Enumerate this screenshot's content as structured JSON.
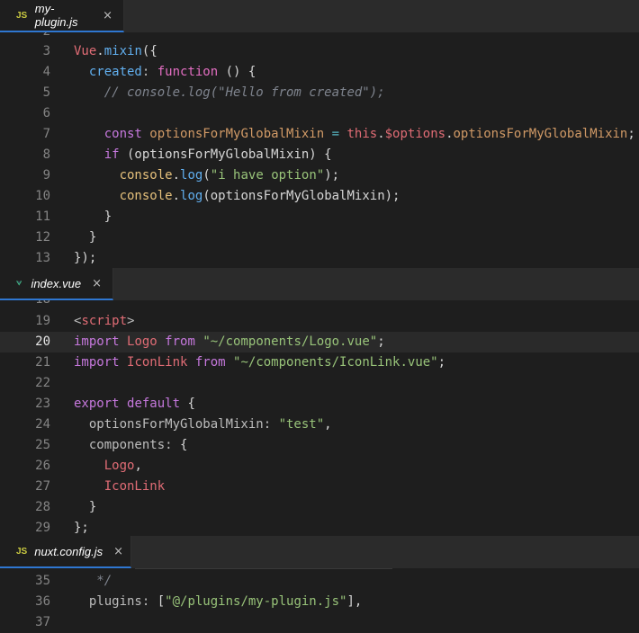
{
  "panes": [
    {
      "tab": {
        "icon": "JS",
        "name": "my-plugin.js",
        "close": "×"
      },
      "top_partial_line": "2",
      "lines": [
        {
          "n": "3",
          "tokens": [
            [
              "r",
              "Vue"
            ],
            [
              "wh",
              "."
            ],
            [
              "b",
              "mixin"
            ],
            [
              "wh",
              "({"
            ]
          ]
        },
        {
          "n": "4",
          "tokens": [
            [
              "wh",
              "  "
            ],
            [
              "b",
              "created"
            ],
            [
              "g",
              ": "
            ],
            [
              "kp",
              "function"
            ],
            [
              "wh",
              " () {"
            ]
          ]
        },
        {
          "n": "5",
          "tokens": [
            [
              "wh",
              "    "
            ],
            [
              "cm",
              "// console.log(\"Hello from created\");"
            ]
          ]
        },
        {
          "n": "6",
          "tokens": []
        },
        {
          "n": "7",
          "tokens": [
            [
              "wh",
              "    "
            ],
            [
              "k",
              "const "
            ],
            [
              "o",
              "optionsForMyGlobalMixin"
            ],
            [
              "c",
              " = "
            ],
            [
              "r",
              "this"
            ],
            [
              "wh",
              "."
            ],
            [
              "r",
              "$options"
            ],
            [
              "wh",
              "."
            ],
            [
              "o",
              "optionsForMyGlobalMixin"
            ],
            [
              "wh",
              ";"
            ]
          ]
        },
        {
          "n": "8",
          "tokens": [
            [
              "wh",
              "    "
            ],
            [
              "k",
              "if"
            ],
            [
              "wh",
              " (optionsForMyGlobalMixin) {"
            ]
          ]
        },
        {
          "n": "9",
          "tokens": [
            [
              "wh",
              "      "
            ],
            [
              "y",
              "console"
            ],
            [
              "wh",
              "."
            ],
            [
              "b",
              "log"
            ],
            [
              "wh",
              "("
            ],
            [
              "s",
              "\"i have option\""
            ],
            [
              "wh",
              ");"
            ]
          ]
        },
        {
          "n": "10",
          "tokens": [
            [
              "wh",
              "      "
            ],
            [
              "y",
              "console"
            ],
            [
              "wh",
              "."
            ],
            [
              "b",
              "log"
            ],
            [
              "wh",
              "(optionsForMyGlobalMixin);"
            ]
          ]
        },
        {
          "n": "11",
          "tokens": [
            [
              "wh",
              "    }"
            ]
          ]
        },
        {
          "n": "12",
          "tokens": [
            [
              "wh",
              "  }"
            ]
          ]
        },
        {
          "n": "13",
          "tokens": [
            [
              "wh",
              "});"
            ]
          ]
        }
      ]
    },
    {
      "tab": {
        "icon": "vue-logo-icon",
        "name": "index.vue",
        "close": "×"
      },
      "top_partial_line": "18",
      "lines": [
        {
          "n": "19",
          "tokens": [
            [
              "g",
              "<"
            ],
            [
              "r",
              "script"
            ],
            [
              "g",
              ">"
            ]
          ]
        },
        {
          "n": "20",
          "current": true,
          "tokens": [
            [
              "k",
              "import "
            ],
            [
              "r",
              "Logo "
            ],
            [
              "k",
              "from "
            ],
            [
              "s",
              "\"~/components/Logo.vue\""
            ],
            [
              "wh",
              ";"
            ]
          ]
        },
        {
          "n": "21",
          "tokens": [
            [
              "k",
              "import "
            ],
            [
              "r",
              "IconLink "
            ],
            [
              "k",
              "from "
            ],
            [
              "s",
              "\"~/components/IconLink.vue\""
            ],
            [
              "wh",
              ";"
            ]
          ]
        },
        {
          "n": "22",
          "tokens": []
        },
        {
          "n": "23",
          "tokens": [
            [
              "k",
              "export "
            ],
            [
              "k",
              "default"
            ],
            [
              "wh",
              " {"
            ]
          ]
        },
        {
          "n": "24",
          "tokens": [
            [
              "wh",
              "  "
            ],
            [
              "g",
              "optionsForMyGlobalMixin: "
            ],
            [
              "s",
              "\"test\""
            ],
            [
              "wh",
              ","
            ]
          ]
        },
        {
          "n": "25",
          "tokens": [
            [
              "wh",
              "  "
            ],
            [
              "g",
              "components: "
            ],
            [
              "wh",
              "{"
            ]
          ]
        },
        {
          "n": "26",
          "tokens": [
            [
              "wh",
              "    "
            ],
            [
              "r",
              "Logo"
            ],
            [
              "wh",
              ","
            ]
          ]
        },
        {
          "n": "27",
          "tokens": [
            [
              "wh",
              "    "
            ],
            [
              "r",
              "IconLink"
            ]
          ]
        },
        {
          "n": "28",
          "tokens": [
            [
              "wh",
              "  }"
            ]
          ]
        },
        {
          "n": "29",
          "tokens": [
            [
              "wh",
              "};"
            ]
          ]
        }
      ]
    },
    {
      "tab": {
        "icon": "JS",
        "name": "nuxt.config.js",
        "close": "×"
      },
      "lines": [
        {
          "n": "35",
          "tokens": [
            [
              "wh",
              "   "
            ],
            [
              "cm",
              "*/"
            ]
          ]
        },
        {
          "n": "36",
          "tokens": [
            [
              "wh",
              "  "
            ],
            [
              "g",
              "plugins: "
            ],
            [
              "wh",
              "["
            ],
            [
              "s",
              "\"@/plugins/my-plugin.js\""
            ],
            [
              "wh",
              "],"
            ]
          ]
        },
        {
          "n": "37",
          "tokens": []
        }
      ]
    }
  ],
  "colors": {
    "active_tab_border": "#2f77d1",
    "js_icon": "#cbcb41",
    "vue_green": "#41b883"
  }
}
